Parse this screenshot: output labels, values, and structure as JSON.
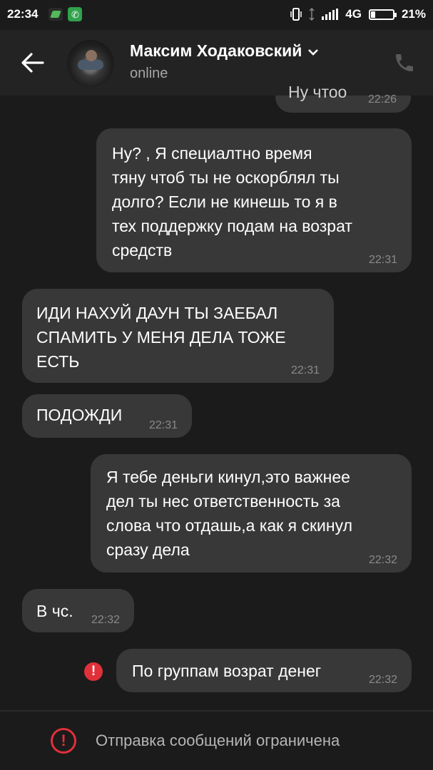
{
  "status_bar": {
    "time": "22:34",
    "network": "4G",
    "battery": "21%",
    "battery_level": 0.21
  },
  "header": {
    "contact_name": "Максим Ходаковский",
    "presence": "online",
    "icons": [
      "back-arrow-icon",
      "chevron-down-icon",
      "phone-icon"
    ]
  },
  "messages": [
    {
      "direction": "out",
      "text": "Ну чтоо",
      "time": "22:26",
      "partial": true
    },
    {
      "direction": "out",
      "text": "Ну? , Я специалтно время\nтяну чтоб ты не оскорблял ты\nдолго? Если не кинешь то я в\nтех поддержку подам на возрат\nсредств",
      "time": "22:31"
    },
    {
      "direction": "in",
      "text": "ИДИ НАХУЙ ДАУН ТЫ ЗАЕБАЛ\nСПАМИТЬ У МЕНЯ ДЕЛА ТОЖЕ\nЕСТЬ",
      "time": "22:31"
    },
    {
      "direction": "in",
      "text": "ПОДОЖДИ",
      "time": "22:31"
    },
    {
      "direction": "out",
      "text": "Я тебе деньги кинул,это важнее\nдел ты нес ответственность за\nслова что отдашь,а как я скинул\nсразу дела",
      "time": "22:32"
    },
    {
      "direction": "in",
      "text": "В чс.",
      "time": "22:32"
    },
    {
      "direction": "out",
      "text": "По группам возрат денег",
      "time": "22:32",
      "failed": true
    }
  ],
  "footer": {
    "restriction_text": "Отправка сообщений ограничена"
  },
  "colors": {
    "background": "#1b1b1b",
    "header": "#232323",
    "bubble": "#383838",
    "error": "#e0313a"
  }
}
